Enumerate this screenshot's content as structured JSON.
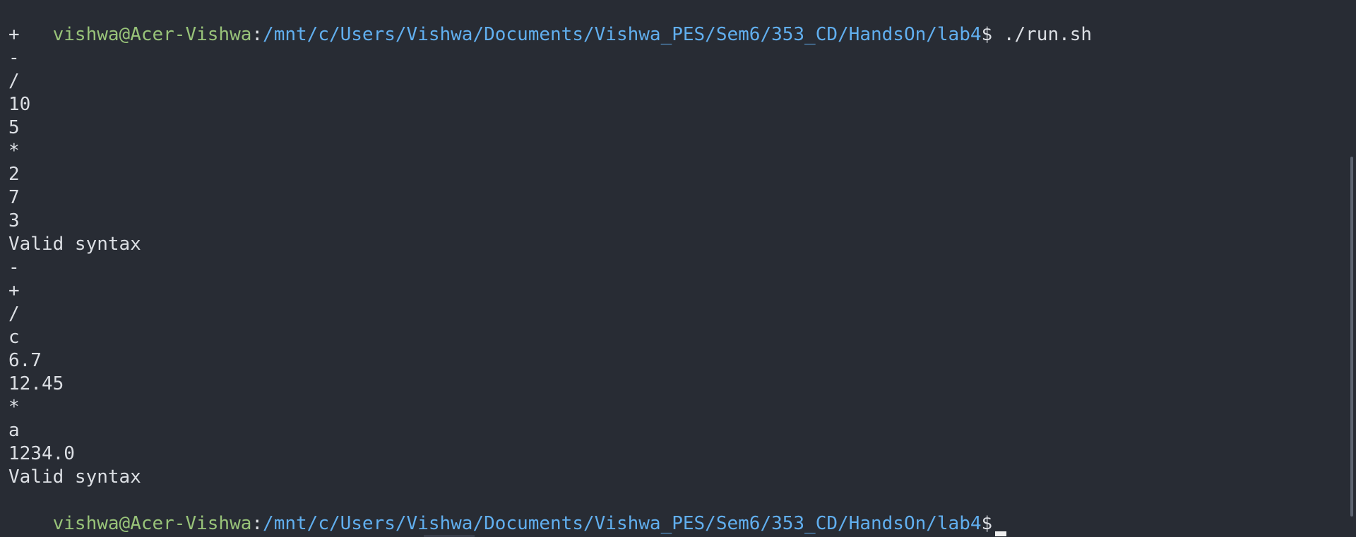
{
  "prompt": {
    "user_host": "vishwa@Acer-Vishwa",
    "separator": ":",
    "path": "/mnt/c/Users/Vishwa/Documents/Vishwa_PES/Sem6/353_CD/HandsOn/lab4",
    "dollar": "$",
    "command": " ./run.sh"
  },
  "output": [
    "+",
    "-",
    "/",
    "10",
    "5",
    "*",
    "2",
    "7",
    "3",
    "Valid syntax",
    "-",
    "+",
    "/",
    "c",
    "6.7",
    "12.45",
    "*",
    "a",
    "1234.0",
    "Valid syntax"
  ],
  "colors": {
    "background": "#282c34",
    "user_host": "#98c379",
    "path": "#61afef",
    "text": "#dcdfe4"
  }
}
